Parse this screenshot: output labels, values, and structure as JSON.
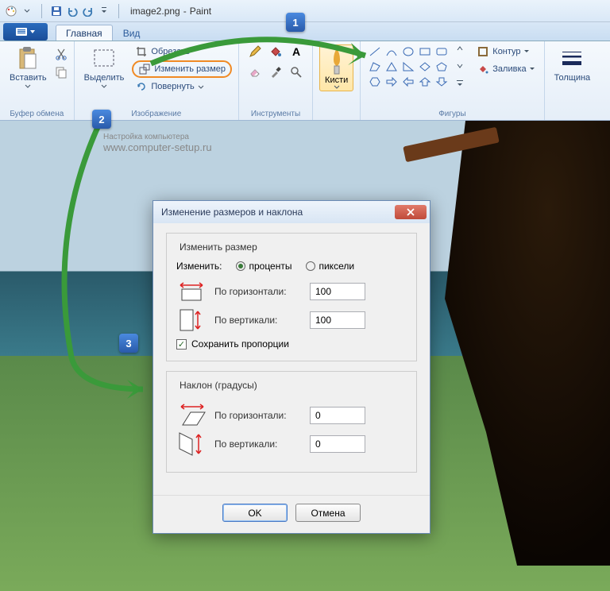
{
  "titlebar": {
    "filename": "image2.png",
    "app": "Paint"
  },
  "tabs": {
    "home": "Главная",
    "view": "Вид"
  },
  "ribbon": {
    "clipboard": {
      "paste": "Вставить",
      "group": "Буфер обмена"
    },
    "image": {
      "select": "Выделить",
      "crop": "Обрезать",
      "resize": "Изменить размер",
      "rotate": "Повернуть",
      "group": "Изображение"
    },
    "tools": {
      "group": "Инструменты"
    },
    "brushes": {
      "label": "Кисти"
    },
    "shapes": {
      "outline": "Контур",
      "fill": "Заливка",
      "group": "Фигуры"
    },
    "size": {
      "label": "Толщина"
    }
  },
  "watermark": {
    "line1": "Настройка компьютера",
    "line2": "www.computer-setup.ru"
  },
  "callouts": {
    "c1": "1",
    "c2": "2",
    "c3": "3"
  },
  "dialog": {
    "title": "Изменение размеров и наклона",
    "resize_legend": "Изменить размер",
    "by_label": "Изменить:",
    "percent": "проценты",
    "pixels": "пиксели",
    "horiz": "По горизонтали:",
    "vert": "По вертикали:",
    "h_val": "100",
    "v_val": "100",
    "keep_aspect": "Сохранить пропорции",
    "skew_legend": "Наклон (градусы)",
    "skew_h": "0",
    "skew_v": "0",
    "ok": "OK",
    "cancel": "Отмена"
  }
}
